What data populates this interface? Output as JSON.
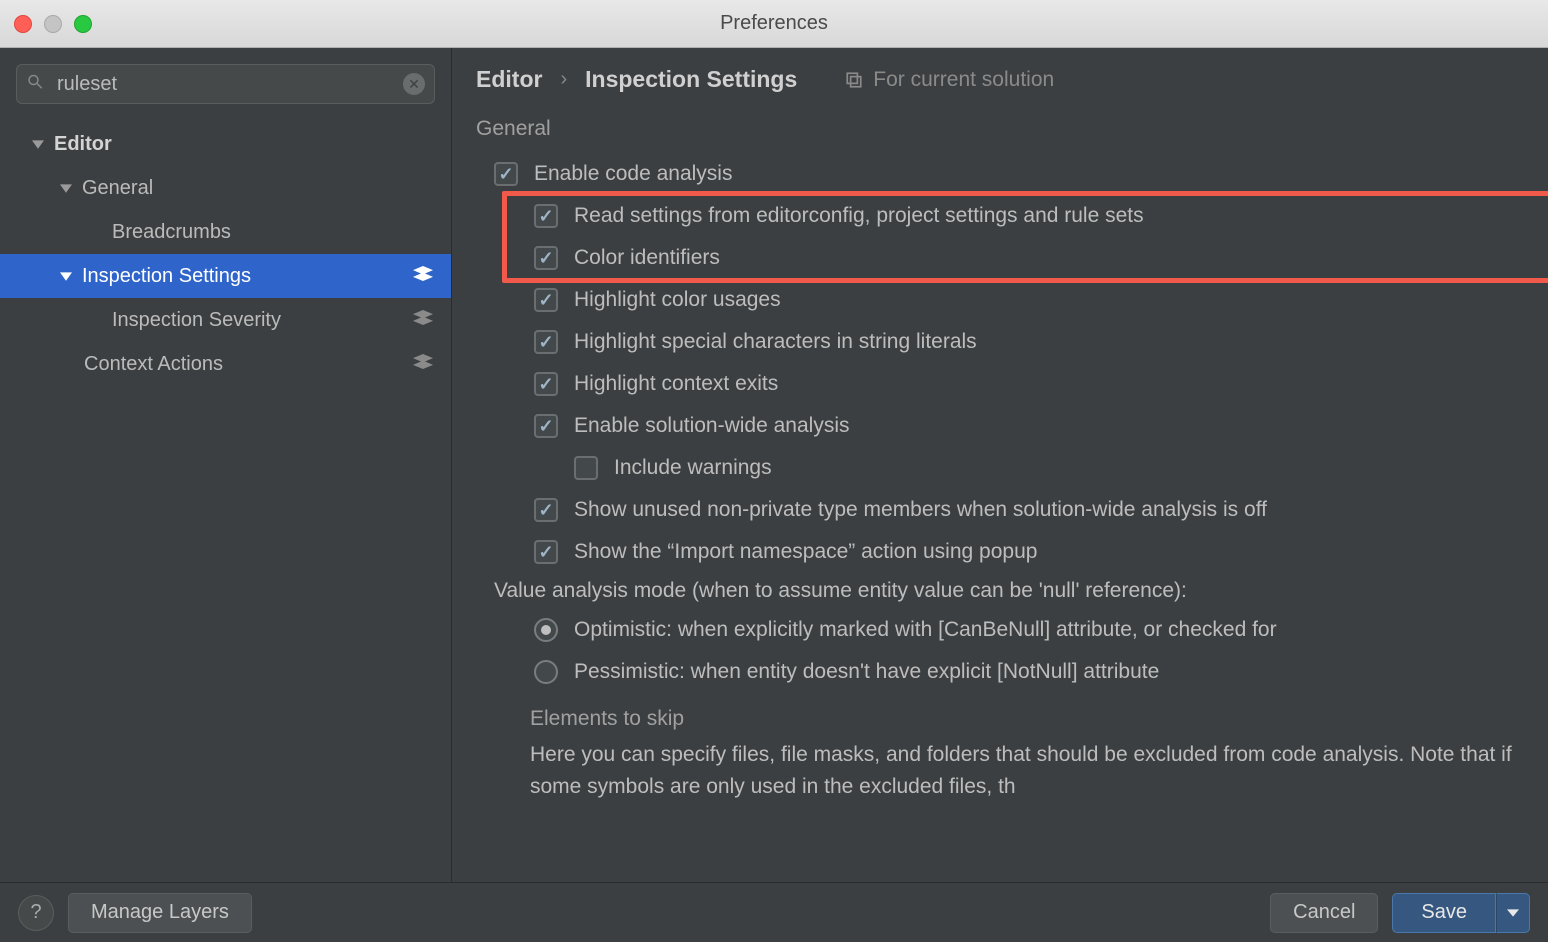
{
  "window": {
    "title": "Preferences"
  },
  "search": {
    "value": "ruleset"
  },
  "sidebar": {
    "items": [
      {
        "label": "Editor",
        "expanded": true,
        "bold": true
      },
      {
        "label": "General",
        "expanded": true
      },
      {
        "label": "Breadcrumbs"
      },
      {
        "label": "Inspection Settings",
        "expanded": true,
        "selected": true,
        "layers": true
      },
      {
        "label": "Inspection Severity",
        "layers": true
      },
      {
        "label": "Context Actions",
        "layers": true
      }
    ]
  },
  "breadcrumb": {
    "items": [
      "Editor",
      "Inspection Settings"
    ],
    "scope": "For current solution"
  },
  "section": "General",
  "options": [
    {
      "type": "checkbox",
      "checked": true,
      "indent": 0,
      "label": "Enable code analysis"
    },
    {
      "type": "checkbox",
      "checked": true,
      "indent": 1,
      "label": "Read settings from editorconfig, project settings and rule sets"
    },
    {
      "type": "checkbox",
      "checked": true,
      "indent": 1,
      "label": "Color identifiers"
    },
    {
      "type": "checkbox",
      "checked": true,
      "indent": 1,
      "label": "Highlight color usages"
    },
    {
      "type": "checkbox",
      "checked": true,
      "indent": 1,
      "label": "Highlight special characters in string literals"
    },
    {
      "type": "checkbox",
      "checked": true,
      "indent": 1,
      "label": "Highlight context exits"
    },
    {
      "type": "checkbox",
      "checked": true,
      "indent": 1,
      "label": "Enable solution-wide analysis"
    },
    {
      "type": "checkbox",
      "checked": false,
      "indent": 2,
      "label": "Include warnings"
    },
    {
      "type": "checkbox",
      "checked": true,
      "indent": 1,
      "label": "Show unused non-private type members when solution-wide analysis is off"
    },
    {
      "type": "checkbox",
      "checked": true,
      "indent": 1,
      "label": "Show the “Import namespace” action using popup"
    }
  ],
  "valueAnalysis": {
    "label": "Value analysis mode (when to assume entity value can be 'null' reference):",
    "radios": [
      {
        "checked": true,
        "label": "Optimistic: when explicitly marked with [CanBeNull] attribute, or checked for"
      },
      {
        "checked": false,
        "label": "Pessimistic: when entity doesn't have explicit [NotNull] attribute"
      }
    ]
  },
  "elementsToSkip": {
    "title": "Elements to skip",
    "text": "Here you can specify files, file masks, and folders that should be excluded from code analysis. Note that if some symbols are only used in the excluded files, th"
  },
  "footer": {
    "manageLayers": "Manage Layers",
    "cancel": "Cancel",
    "save": "Save"
  }
}
